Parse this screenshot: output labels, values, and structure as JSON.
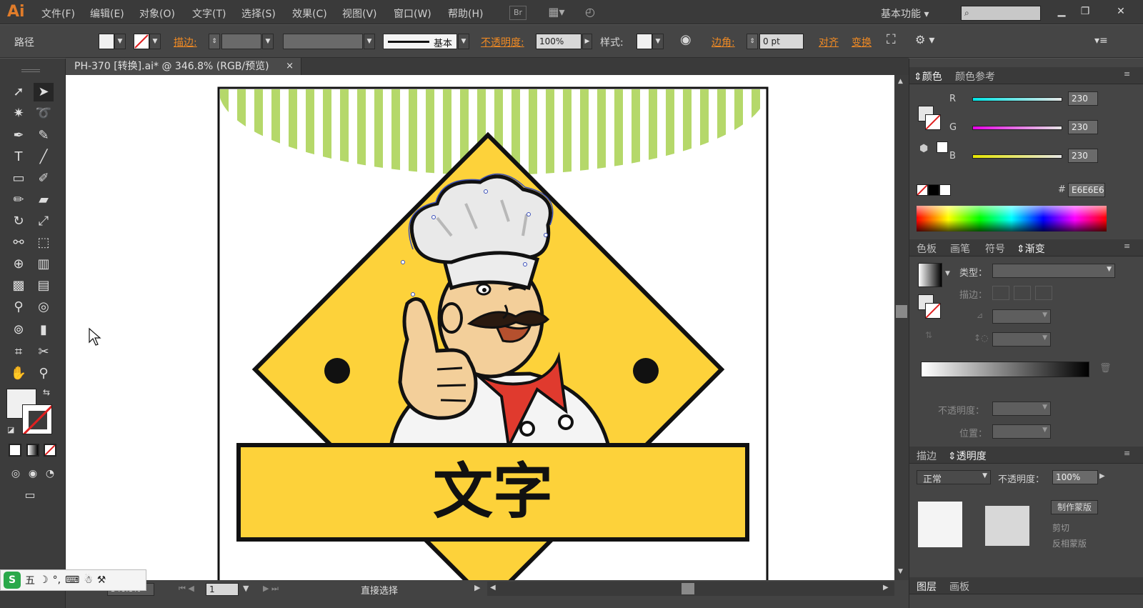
{
  "app": {
    "logo": "Ai"
  },
  "menu": {
    "items": [
      "文件(F)",
      "编辑(E)",
      "对象(O)",
      "文字(T)",
      "选择(S)",
      "效果(C)",
      "视图(V)",
      "窗口(W)",
      "帮助(H)"
    ],
    "bridge": "Br",
    "workspace": "基本功能",
    "search_placeholder": ""
  },
  "control": {
    "object_type": "路径",
    "stroke_label": "描边",
    "stroke_style": "基本",
    "opacity_label": "不透明度",
    "opacity_value": "100%",
    "style_label": "样式",
    "corner_label": "边角",
    "corner_value": "0 pt",
    "align_label": "对齐",
    "transform_label": "变换"
  },
  "document": {
    "tab_title": "PH-370 [转换].ai* @ 346.8% (RGB/预览)",
    "close": "×"
  },
  "artwork": {
    "banner_text": "文字",
    "colors": {
      "yellow": "#fdd23a",
      "stripe": "#b5d86a",
      "outline": "#111111"
    }
  },
  "status": {
    "zoom": "346.8%",
    "page": "1",
    "tool": "直接选择"
  },
  "color_panel": {
    "tabs": [
      "颜色",
      "颜色参考"
    ],
    "r_label": "R",
    "g_label": "G",
    "b_label": "B",
    "r": "230",
    "g": "230",
    "b": "230",
    "hash": "#",
    "hex": "E6E6E6"
  },
  "gradient_panel": {
    "tabs": [
      "色板",
      "画笔",
      "符号",
      "渐变"
    ],
    "type_label": "类型：",
    "stroke_label": "描边：",
    "opacity_label": "不透明度：",
    "position_label": "位置："
  },
  "transparency_panel": {
    "tabs": [
      "描边",
      "透明度"
    ],
    "mode": "正常",
    "opacity_label": "不透明度：",
    "opacity_value": "100%",
    "make_mask": "制作蒙版",
    "clip": "剪切",
    "invert": "反相蒙版"
  },
  "bottom_panel": {
    "tabs": [
      "图层",
      "画板"
    ]
  },
  "ime": {
    "mode": "五"
  }
}
